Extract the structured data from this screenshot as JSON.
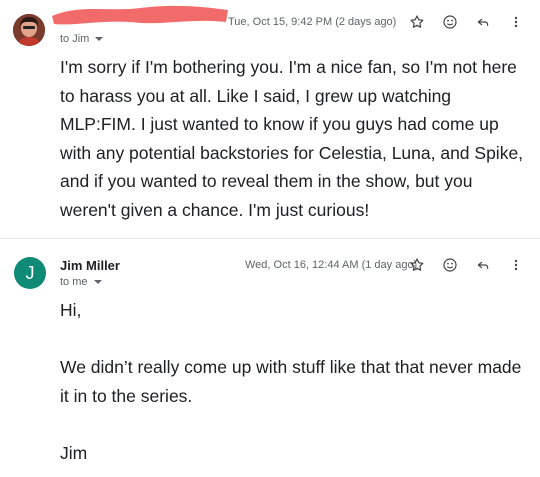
{
  "message1": {
    "date": "Tue, Oct 15, 9:42 PM (2 days ago)",
    "to": "to Jim",
    "body": "I'm sorry if I'm bothering you. I'm a nice fan, so I'm not here to harass you at all. Like I said, I grew up watching MLP:FIM. I just wanted to know if you guys had come up with any potential backstories for Celestia, Luna, and Spike, and if you wanted to reveal them in the show, but you weren't given a chance. I'm just curious!"
  },
  "message2": {
    "avatar_initial": "J",
    "sender": "Jim Miller",
    "date": "Wed, Oct 16, 12:44 AM (1 day ago)",
    "to": "to me",
    "body": {
      "greeting": "Hi,",
      "text": "We didn’t really come up with stuff like that that never made it in to the series.",
      "signoff": "Jim"
    }
  },
  "colors": {
    "redaction": "#f26b6b",
    "avatar_j": "#0f8a74"
  },
  "icons": [
    "star-icon",
    "emoji-icon",
    "reply-icon",
    "more-vert-icon"
  ]
}
